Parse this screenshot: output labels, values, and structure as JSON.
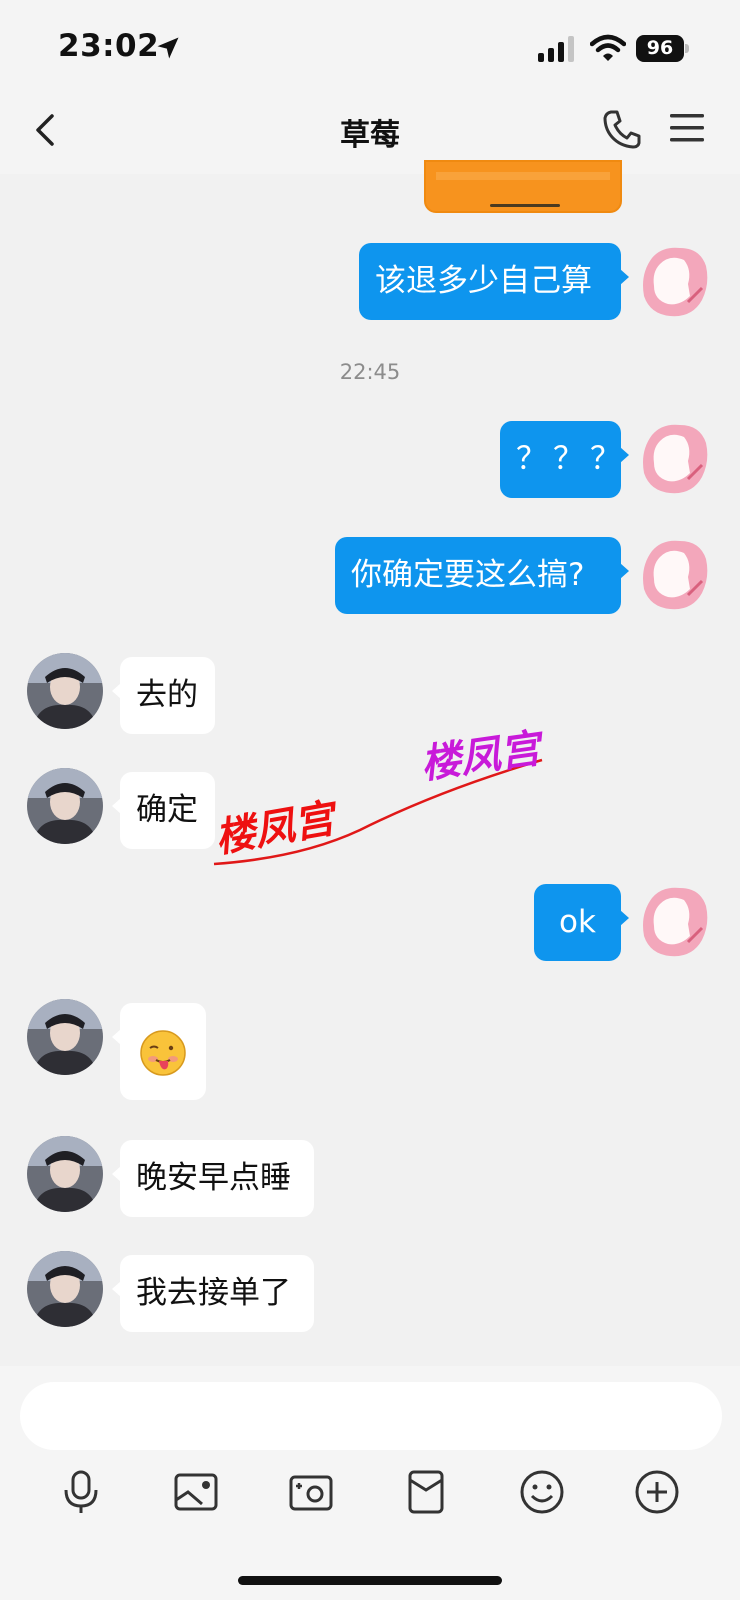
{
  "status_bar": {
    "time": "23:02",
    "battery": "96"
  },
  "header": {
    "title": "草莓"
  },
  "messages": {
    "m1": "该退多少自己算",
    "timestamp": "22:45",
    "m2": "？？？",
    "m3": "你确定要这么搞?",
    "m4": "去的",
    "m5": "确定",
    "m6": "ok",
    "m7_emoji": "tongue-face-emoji",
    "m8": "晚安早点睡",
    "m9": "我去接单了"
  },
  "watermark": {
    "text_1": "楼凤宫",
    "text_2": "楼凤宫"
  },
  "input": {
    "value": "",
    "placeholder": ""
  },
  "toolbar": {
    "icons": [
      "microphone-icon",
      "image-icon",
      "camera-icon",
      "red-packet-icon",
      "emoji-icon",
      "plus-icon"
    ]
  },
  "colors": {
    "outgoing_bubble": "#0e95ee",
    "incoming_bubble": "#ffffff",
    "background": "#f1f1f1",
    "card": "#f7931e"
  }
}
